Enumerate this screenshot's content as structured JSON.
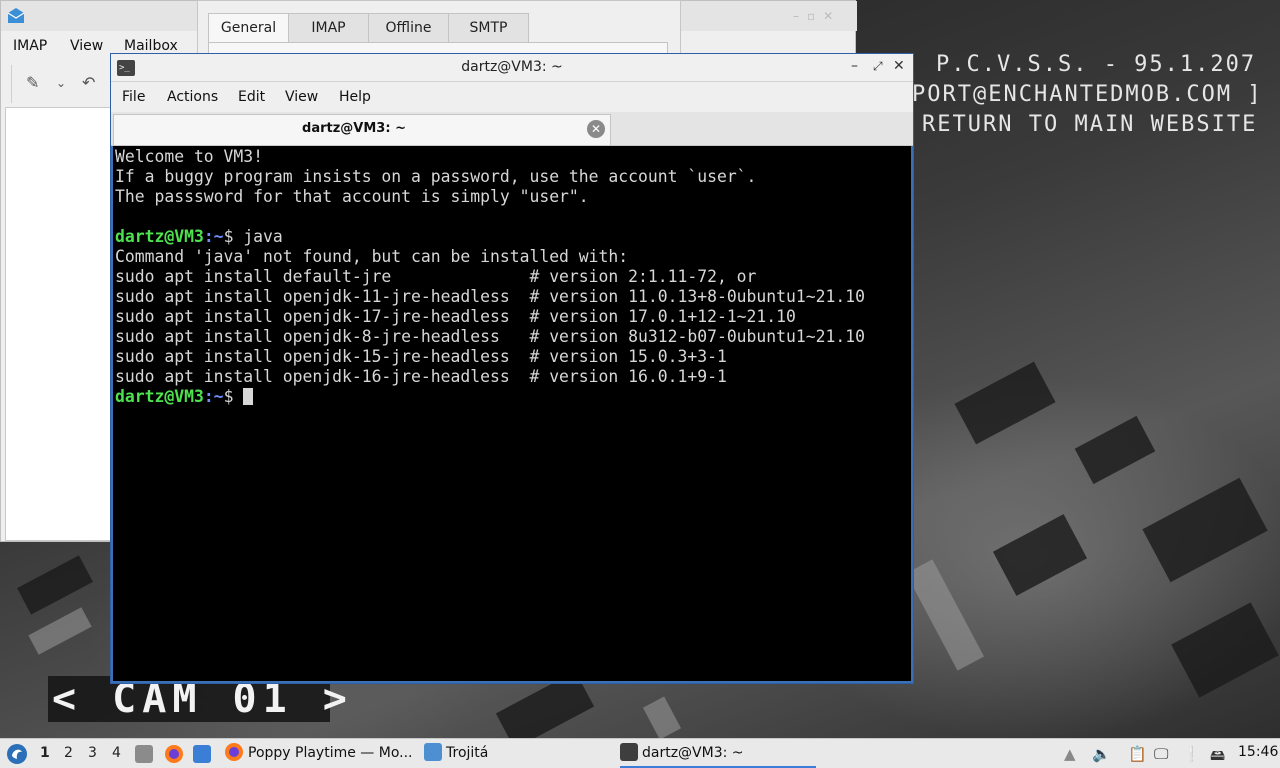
{
  "wallpaper": {
    "overlay_line1": "P.C.V.S.S. - 95.1.207",
    "overlay_line2": "PORT@ENCHANTEDMOB.COM ]",
    "overlay_line3": "RETURN TO MAIN WEBSITE",
    "cam_label": "< CAM 01 >"
  },
  "mail_window": {
    "menu": [
      "IMAP",
      "View",
      "Mailbox"
    ],
    "settings_tabs": [
      "General",
      "IMAP",
      "Offline",
      "SMTP"
    ],
    "active_tab": "General"
  },
  "terminal": {
    "window_title": "dartz@VM3: ~",
    "menu": [
      "File",
      "Actions",
      "Edit",
      "View",
      "Help"
    ],
    "tab_title": "dartz@VM3: ~",
    "prompt_user": "dartz@VM3",
    "prompt_path": ":~",
    "prompt_symbol": "$ ",
    "lines": [
      {
        "type": "text",
        "text": "Welcome to VM3!"
      },
      {
        "type": "text",
        "text": "If a buggy program insists on a password, use the account `user`."
      },
      {
        "type": "text",
        "text": "The passsword for that account is simply \"user\"."
      },
      {
        "type": "text",
        "text": ""
      },
      {
        "type": "prompt",
        "text": "java"
      },
      {
        "type": "text",
        "text": "Command 'java' not found, but can be installed with:"
      },
      {
        "type": "text",
        "text": "sudo apt install default-jre              # version 2:1.11-72, or"
      },
      {
        "type": "text",
        "text": "sudo apt install openjdk-11-jre-headless  # version 11.0.13+8-0ubuntu1~21.10"
      },
      {
        "type": "text",
        "text": "sudo apt install openjdk-17-jre-headless  # version 17.0.1+12-1~21.10"
      },
      {
        "type": "text",
        "text": "sudo apt install openjdk-8-jre-headless   # version 8u312-b07-0ubuntu1~21.10"
      },
      {
        "type": "text",
        "text": "sudo apt install openjdk-15-jre-headless  # version 15.0.3+3-1"
      },
      {
        "type": "text",
        "text": "sudo apt install openjdk-16-jre-headless  # version 16.0.1+9-1"
      },
      {
        "type": "prompt_cursor",
        "text": ""
      }
    ]
  },
  "taskbar": {
    "workspaces": [
      "1",
      "2",
      "3",
      "4"
    ],
    "active_workspace": "1",
    "tasks": [
      "Poppy Playtime — Mo...",
      "Trojitá",
      "dartz@VM3: ~"
    ],
    "clock": "15:46"
  },
  "colors": {
    "terminal_bg": "#000000",
    "terminal_fg": "#d7d7d7",
    "prompt_user": "#4fe24f",
    "prompt_path": "#6f8cff",
    "window_border": "#3b6fb6",
    "taskbar_bg": "#e9e9e9"
  }
}
